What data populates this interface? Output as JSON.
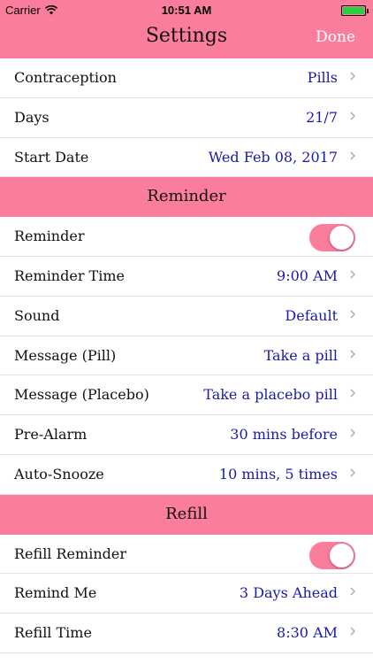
{
  "status_bar": {
    "carrier": "Carrier",
    "time": "10:51 AM"
  },
  "nav": {
    "title": "Settings",
    "done_label": "Done"
  },
  "rows_top": [
    {
      "label": "Contraception",
      "value": "Pills"
    },
    {
      "label": "Days",
      "value": "21/7"
    },
    {
      "label": "Start Date",
      "value": "Wed Feb 08, 2017"
    }
  ],
  "section_reminder": "Reminder",
  "reminder_toggle": {
    "label": "Reminder",
    "on": true
  },
  "rows_reminder": [
    {
      "label": "Reminder Time",
      "value": "9:00 AM"
    },
    {
      "label": "Sound",
      "value": "Default"
    },
    {
      "label": "Message (Pill)",
      "value": "Take a pill"
    },
    {
      "label": "Message (Placebo)",
      "value": "Take a placebo pill"
    },
    {
      "label": "Pre-Alarm",
      "value": "30 mins before"
    },
    {
      "label": "Auto-Snooze",
      "value": "10 mins, 5 times"
    }
  ],
  "section_refill": "Refill",
  "refill_toggle": {
    "label": "Refill Reminder",
    "on": true
  },
  "rows_refill": [
    {
      "label": "Remind Me",
      "value": "3 Days Ahead"
    },
    {
      "label": "Refill Time",
      "value": "8:30 AM"
    }
  ],
  "colors": {
    "accent": "#fb7d9c",
    "value_text": "#1a1aa8"
  }
}
